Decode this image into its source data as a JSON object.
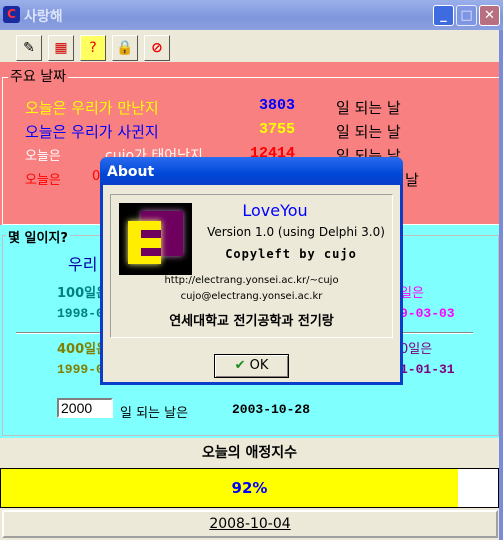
{
  "window": {
    "title": "사랑해",
    "buttons": [
      "minimize",
      "maximize",
      "close"
    ]
  },
  "toolbar": {
    "tools": [
      {
        "icon": "settings-pen-icon"
      },
      {
        "icon": "calendar-icon"
      },
      {
        "icon": "help-icon"
      },
      {
        "icon": "lock-icon"
      },
      {
        "icon": "stop-icon"
      }
    ]
  },
  "important_dates": {
    "legend": "주요 날짜",
    "rows": [
      {
        "label": "오늘은 우리가 만난지",
        "value": "3803",
        "suffix": "일 되는 날",
        "color": "#ffff00",
        "value_color": "#0000ff"
      },
      {
        "label": "오늘은 우리가 사귄지",
        "value": "3755",
        "suffix": "일 되는 날",
        "color": "#0000ff",
        "value_color": "#ffff00"
      },
      {
        "label": "오늘은",
        "label2": "cujo가 태어난지",
        "value": "12414",
        "suffix": "일 되는 날",
        "color": "#ffffff",
        "value_color": "#ff0000"
      },
      {
        "label": "오늘은",
        "label2": "0",
        "suffix": "날",
        "color": "#ff0000"
      }
    ]
  },
  "days": {
    "legend": "몇 일이지?",
    "heading": "우리",
    "left1_label": "100일은",
    "left1_date": "1998-0",
    "right1_label": "일은",
    "right1_date": "9-03-03",
    "left2_label": "400일은",
    "left2_date": "1999-0",
    "right2_label": "0일은",
    "right2_date": "1-01-31",
    "input_value": "2000",
    "input_suffix": "일 되는 날은",
    "result_date": "2003-10-28"
  },
  "affection": {
    "label": "오늘의 애정지수",
    "percent": 92,
    "percent_text": "92%"
  },
  "date_button": "2008-10-04",
  "about": {
    "title": "About",
    "app_name": "LoveYou",
    "version": "Version 1.0  (using Delphi 3.0)",
    "copyleft": "Copyleft by cujo",
    "url": "http://electrang.yonsei.ac.kr/~cujo",
    "email": "cujo@electrang.yonsei.ac.kr",
    "org": "연세대학교 전기공학과 전기랑",
    "ok": "OK"
  }
}
